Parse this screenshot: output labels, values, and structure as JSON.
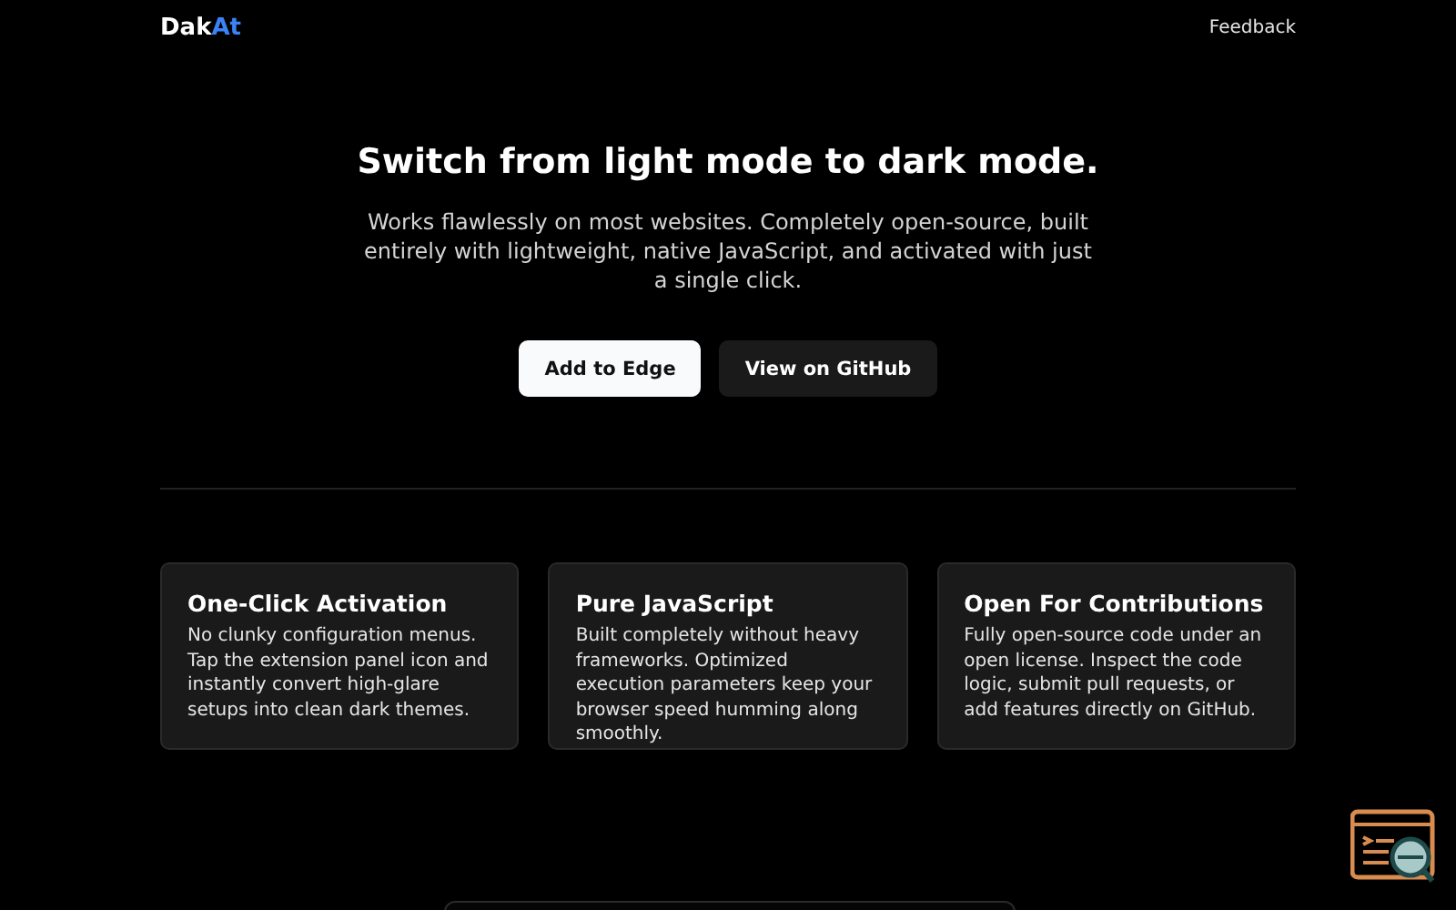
{
  "header": {
    "logo": {
      "text": "Dak",
      "accent": "At"
    },
    "link": "Feedback"
  },
  "hero": {
    "title": "Switch from light mode to dark mode.",
    "description": "Works flawlessly on most websites. Completely open-source, built entirely with lightweight, native JavaScript, and activated with just a single click.",
    "buttons": [
      {
        "label": "Add to Edge",
        "kind": "primary"
      },
      {
        "label": "View on GitHub",
        "kind": "secondary"
      }
    ]
  },
  "features": [
    {
      "title": "One-Click Activation",
      "text": "No clunky configuration menus. Tap the extension panel icon and instantly convert high-glare setups into clean dark themes."
    },
    {
      "title": "Pure JavaScript",
      "text": "Built completely without heavy frameworks. Optimized execution parameters keep your browser speed humming along smoothly."
    },
    {
      "title": "Open For Contributions",
      "text": "Fully open-source code under an open license. Inspect the code logic, submit pull requests, or add features directly on GitHub."
    }
  ]
}
